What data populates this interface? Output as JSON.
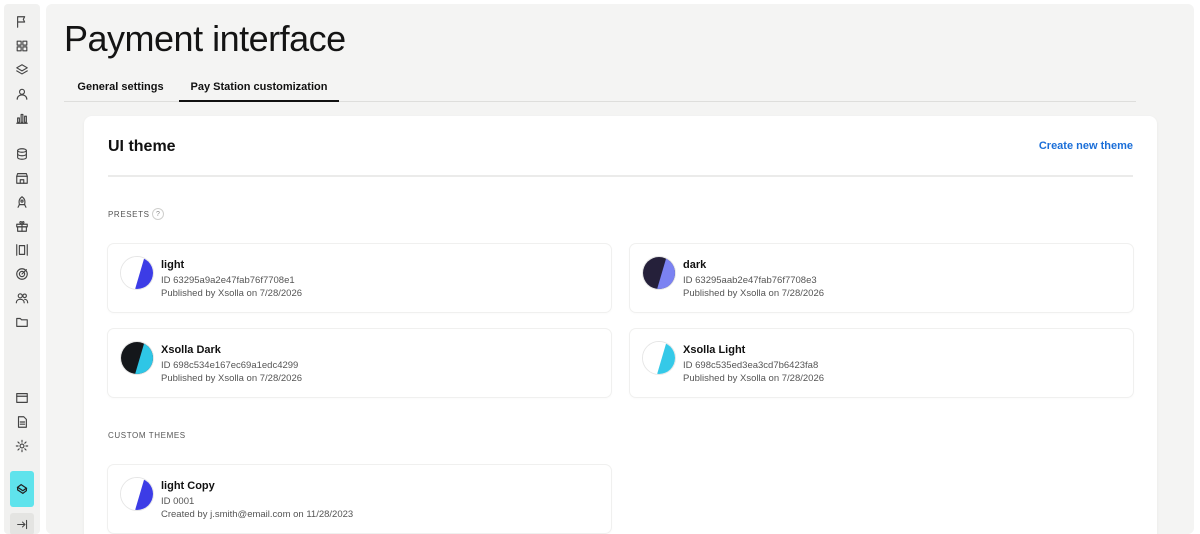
{
  "sidebar": {
    "icons": [
      "flag-icon",
      "grid-icon",
      "layers-icon",
      "user-icon",
      "chart-icon",
      "database-icon",
      "store-icon",
      "rocket-icon",
      "gift-icon",
      "columns-icon",
      "target-icon",
      "users-icon",
      "folder-icon",
      "window-icon",
      "document-icon",
      "gear-icon"
    ],
    "active_icon": "tag-icon",
    "collapse_icon": "collapse-arrow-icon",
    "active_color": "#5fe3ec"
  },
  "page": {
    "title": "Payment interface",
    "tabs": [
      {
        "label": "General settings",
        "active": false
      },
      {
        "label": "Pay Station customization",
        "active": true
      }
    ]
  },
  "card": {
    "title": "UI theme",
    "create_link": "Create new theme",
    "presets_label": "PRESETS",
    "help_glyph": "?",
    "custom_label": "CUSTOM THEMES",
    "presets": [
      {
        "name": "light",
        "id": "ID 63295a9a2e47fab76f7708e1",
        "published": "Published by Xsolla on 7/28/2026",
        "bg": "#ffffff",
        "accent": "#3c3ce6"
      },
      {
        "name": "dark",
        "id": "ID 63295aab2e47fab76f7708e3",
        "published": "Published by Xsolla on 7/28/2026",
        "bg": "#25203a",
        "accent": "#7b82f2"
      },
      {
        "name": "Xsolla Dark",
        "id": "ID 698c534e167ec69a1edc4299",
        "published": "Published by Xsolla on 7/28/2026",
        "bg": "#14171b",
        "accent": "#2ec6e6"
      },
      {
        "name": "Xsolla Light",
        "id": "ID 698c535ed3ea3cd7b6423fa8",
        "published": "Published by Xsolla on 7/28/2026",
        "bg": "#ffffff",
        "accent": "#35c9e8"
      }
    ],
    "custom": [
      {
        "name": "light Copy",
        "id": "ID 0001",
        "published": "Created by j.smith@email.com on 11/28/2023",
        "bg": "#ffffff",
        "accent": "#3c3ce6"
      }
    ]
  },
  "colors": {
    "link": "#1a6ed8",
    "background": "#f4f4f3"
  }
}
